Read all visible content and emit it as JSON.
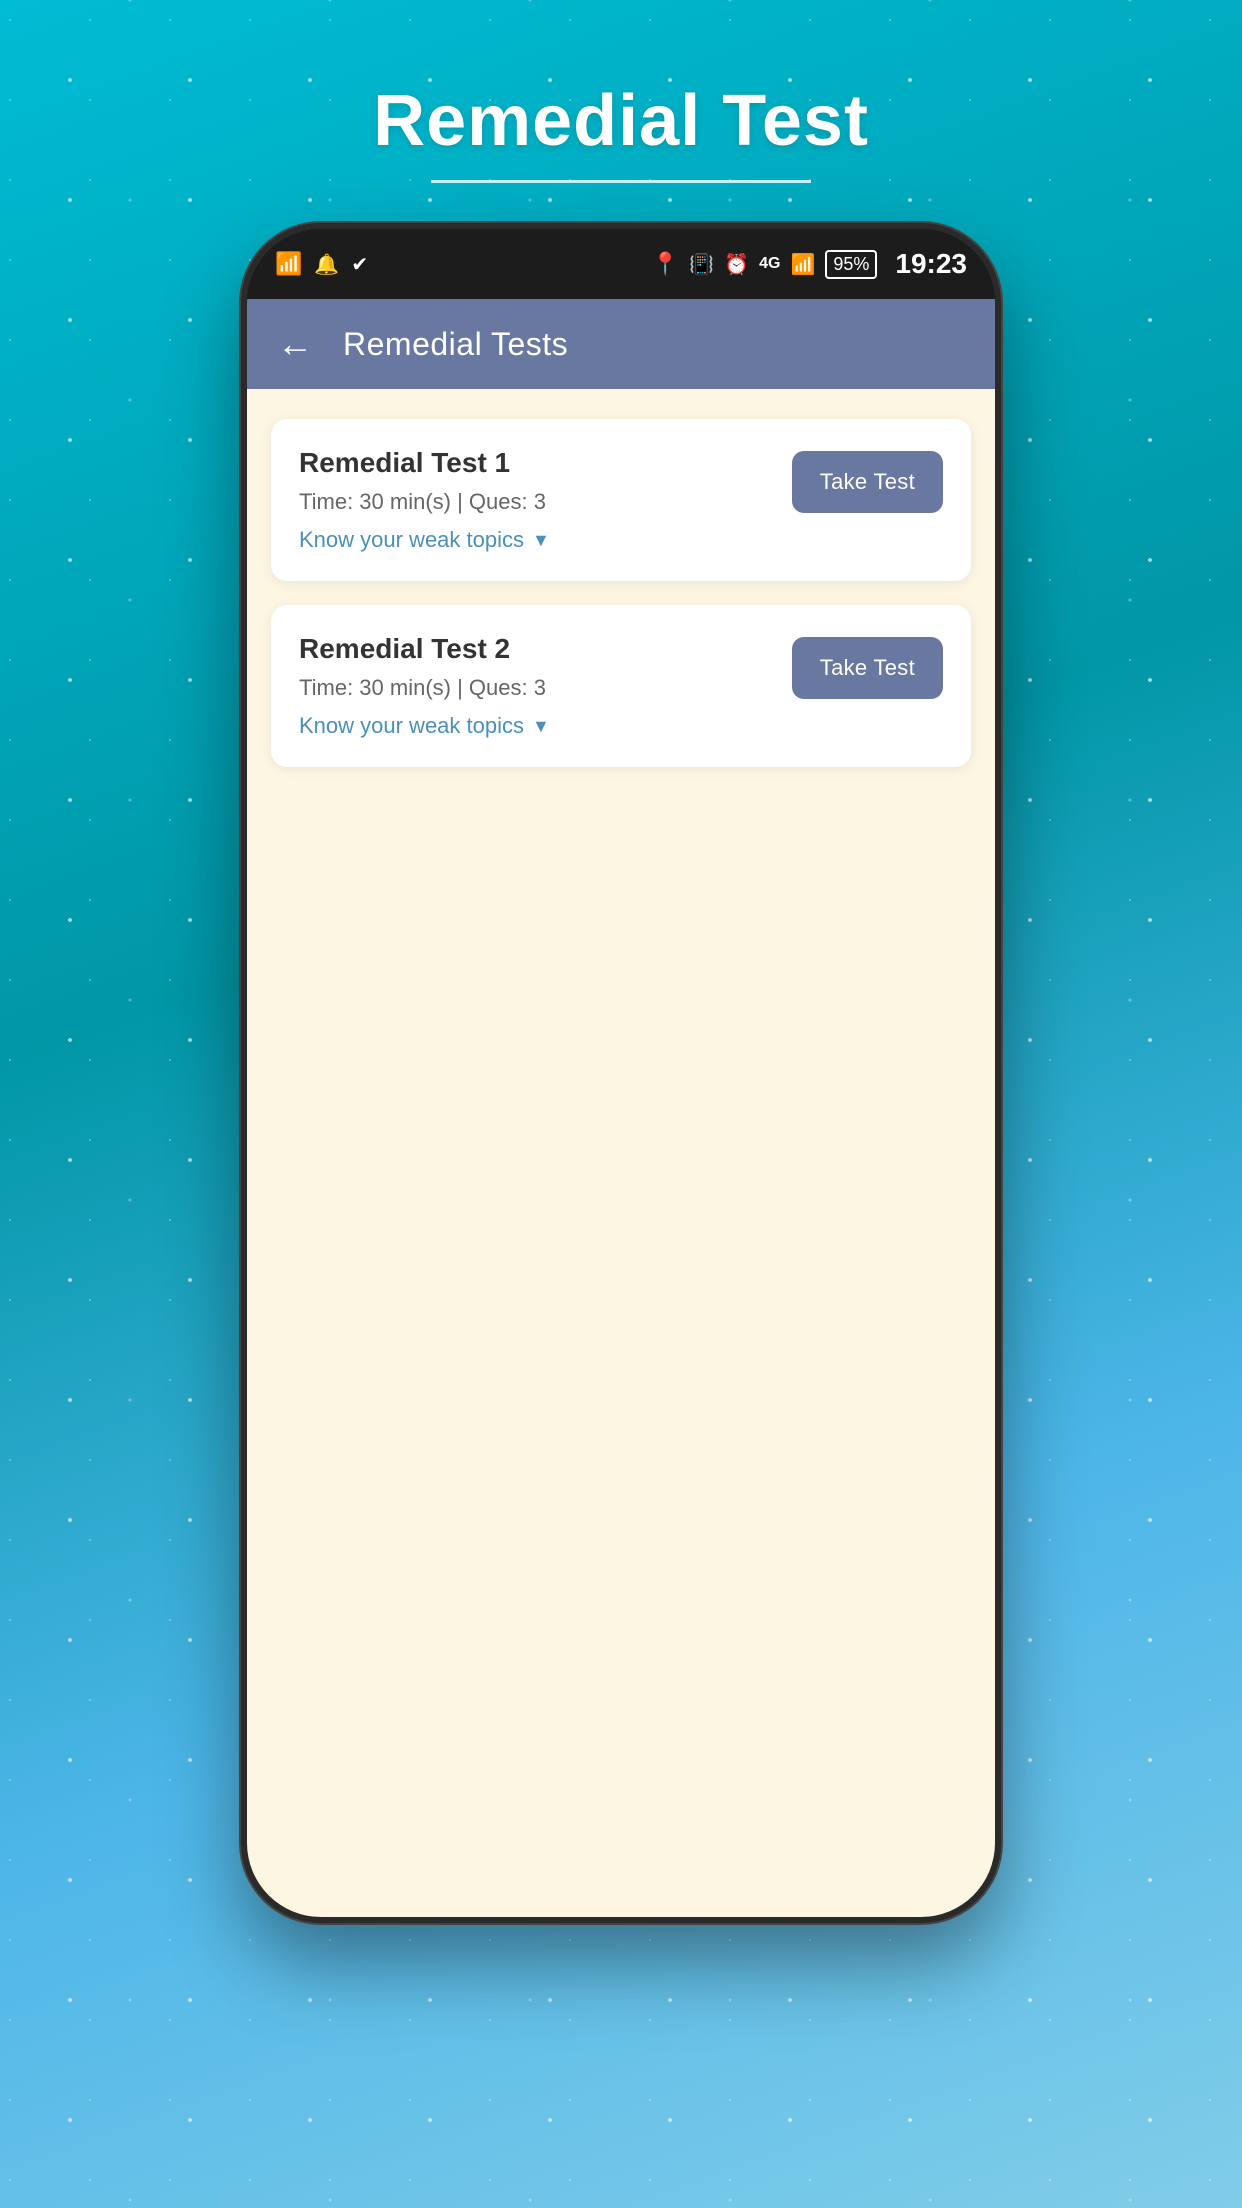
{
  "page": {
    "title": "Remedial Test",
    "title_underline": true
  },
  "status_bar": {
    "time": "19:23",
    "battery_percent": "95%",
    "network": "4G",
    "icons": [
      "wifi-icon",
      "notification-icon",
      "check-icon",
      "location-icon",
      "vibrate-icon",
      "alarm-icon",
      "signal-icon",
      "battery-icon"
    ]
  },
  "header": {
    "title": "Remedial Tests",
    "back_label": "←"
  },
  "tests": [
    {
      "id": 1,
      "name": "Remedial Test 1",
      "time": "Time: 30 min(s) | Ques: 3",
      "weak_topics_label": "Know your weak topics",
      "take_test_label": "Take Test"
    },
    {
      "id": 2,
      "name": "Remedial Test 2",
      "time": "Time: 30 min(s) | Ques: 3",
      "weak_topics_label": "Know your weak topics",
      "take_test_label": "Take Test"
    }
  ],
  "colors": {
    "background_gradient_start": "#00bcd4",
    "background_gradient_end": "#0097a7",
    "header_bg": "#6978a0",
    "content_bg": "#fdf6e3",
    "card_bg": "#ffffff",
    "button_bg": "#6978a0",
    "link_color": "#4a90b8",
    "title_color": "#ffffff",
    "text_primary": "#333333",
    "text_secondary": "#666666"
  }
}
